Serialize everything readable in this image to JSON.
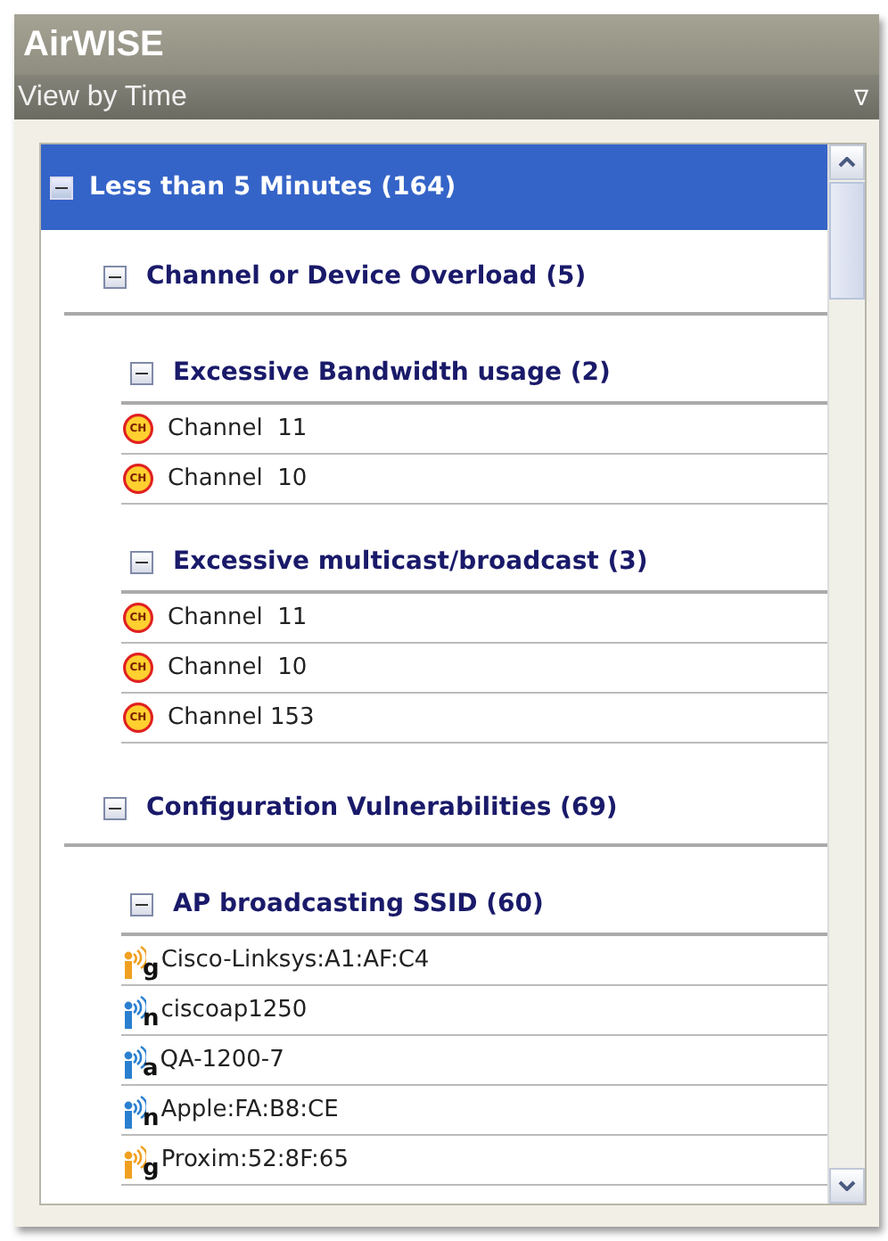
{
  "window": {
    "title": "AirWISE"
  },
  "view_bar": {
    "label": "View by Time",
    "menu": "∇"
  },
  "tree": [
    {
      "label": "Less than 5 Minutes (164)",
      "selected": true,
      "expanded": true,
      "children": [
        {
          "label": "Channel or Device Overload (5)",
          "expanded": true,
          "children": [
            {
              "label": "Excessive Bandwidth usage (2)",
              "expanded": true,
              "items": [
                {
                  "kind": "channel",
                  "badge": "CH",
                  "text": "Channel  11"
                },
                {
                  "kind": "channel",
                  "badge": "CH",
                  "text": "Channel  10"
                }
              ]
            },
            {
              "label": "Excessive multicast/broadcast (3)",
              "expanded": true,
              "items": [
                {
                  "kind": "channel",
                  "badge": "CH",
                  "text": "Channel  11"
                },
                {
                  "kind": "channel",
                  "badge": "CH",
                  "text": "Channel  10"
                },
                {
                  "kind": "channel",
                  "badge": "CH",
                  "text": "Channel 153"
                }
              ]
            }
          ]
        },
        {
          "label": "Configuration Vulnerabilities (69)",
          "expanded": true,
          "children": [
            {
              "label": "AP broadcasting SSID (60)",
              "expanded": true,
              "items": [
                {
                  "kind": "ap",
                  "band": "g",
                  "color": "#f0a020",
                  "text": "Cisco-Linksys:A1:AF:C4"
                },
                {
                  "kind": "ap",
                  "band": "n",
                  "color": "#2a7fd0",
                  "text": "ciscoap1250"
                },
                {
                  "kind": "ap",
                  "band": "a",
                  "color": "#2a7fd0",
                  "text": "QA-1200-7"
                },
                {
                  "kind": "ap",
                  "band": "n",
                  "color": "#2a7fd0",
                  "text": "Apple:FA:B8:CE"
                },
                {
                  "kind": "ap",
                  "band": "g",
                  "color": "#f0a020",
                  "text": "Proxim:52:8F:65"
                }
              ]
            }
          ]
        }
      ]
    }
  ]
}
